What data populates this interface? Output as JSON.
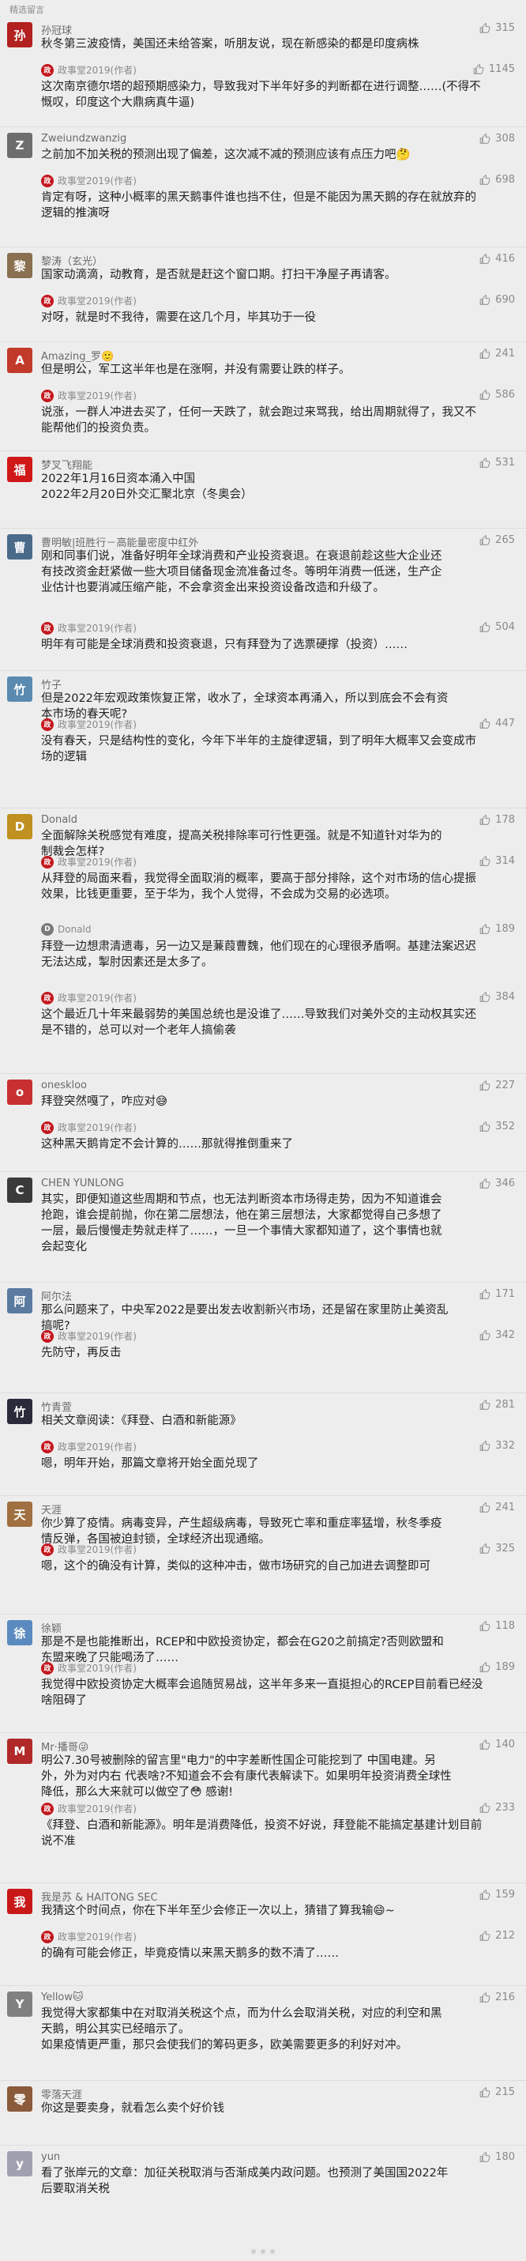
{
  "section_title": "精选留言",
  "comments": [
    {
      "name": "孙冠球",
      "avatar_char": "孙",
      "avatar_color": "#b22020",
      "likes": "315",
      "text": "秋冬第三波疫情，美国还未给答案，听朋友说，现在新感染的都是印度病株",
      "reply": {
        "name": "政事堂2019(作者)",
        "likes": "1145",
        "text": "这次南京德尔塔的超预期感染力，导致我对下半年好多的判断都在进行调整……(不得不慨叹，印度这个大鼎病真牛逼)"
      }
    },
    {
      "name": "Zweiundzwanzig",
      "avatar_char": "Z",
      "avatar_color": "#6d6d6d",
      "likes": "308",
      "text": "之前加不加关税的预测出现了偏差，这次减不减的预测应该有点压力吧🤔",
      "reply": {
        "name": "政事堂2019(作者)",
        "likes": "698",
        "text": "肯定有呀，这种小概率的黑天鹅事件谁也挡不住，但是不能因为黑天鹅的存在就放弃的逻辑的推演呀"
      }
    },
    {
      "name": "黎涛（玄光）",
      "avatar_char": "黎",
      "avatar_color": "#8a7050",
      "likes": "416",
      "text": "国家动滴滴，动教育，是否就是赶这个窗口期。打扫干净屋子再请客。",
      "reply": {
        "name": "政事堂2019(作者)",
        "likes": "690",
        "text": "对呀，就是时不我待，需要在这几个月，毕其功于一役"
      }
    },
    {
      "name": "Amazing_罗🙂",
      "avatar_char": "A",
      "avatar_color": "#c23a2a",
      "likes": "241",
      "text": "但是明公，军工这半年也是在涨啊，并没有需要让跌的样子。",
      "reply": {
        "name": "政事堂2019(作者)",
        "likes": "586",
        "text": "说涨，一群人冲进去买了，任何一天跌了，就会跑过来骂我，给出周期就得了，我又不能帮他们的投资负责。"
      }
    },
    {
      "name": "梦叉飞翔能",
      "avatar_char": "福",
      "avatar_color": "#d01818",
      "likes": "531",
      "text": "2022年1月16日资本涌入中国\n2022年2月20日外交汇聚北京（冬奥会）",
      "reply": null
    },
    {
      "name": "曹明敏|班胜行－高能量密度中红外",
      "avatar_char": "曹",
      "avatar_color": "#4a6a8a",
      "likes": "265",
      "text": "刚和同事们说，准备好明年全球消费和产业投资衰退。在衰退前趁这些大企业还有技改资金赶紧做一些大项目储备现金流准备过冬。等明年消费一低迷，生产企业估计也要消减压缩产能，不会拿资金出来投资设备改造和升级了。",
      "reply": {
        "name": "政事堂2019(作者)",
        "likes": "504",
        "text": "明年有可能是全球消费和投资衰退，只有拜登为了选票硬撑（投资）……"
      }
    },
    {
      "name": "竹子",
      "avatar_char": "竹",
      "avatar_color": "#5a8ab0",
      "likes": "",
      "text": "但是2022年宏观政策恢复正常，收水了，全球资本再涌入，所以到底会不会有资本市场的春天呢?",
      "reply": {
        "name": "政事堂2019(作者)",
        "likes": "447",
        "text": "没有春天，只是结构性的变化，今年下半年的主旋律逻辑，到了明年大概率又会变成市场的逻辑"
      }
    },
    {
      "name": "Donald",
      "avatar_char": "D",
      "avatar_color": "#c09020",
      "likes": "178",
      "text": "全面解除关税感觉有难度，提高关税排除率可行性更强。就是不知道针对华为的制裁会怎样?",
      "reply": {
        "name": "政事堂2019(作者)",
        "likes": "314",
        "text": "从拜登的局面来看，我觉得全面取消的概率，要高于部分排除，这个对市场的信心提振效果，比钱更重要，至于华为，我个人觉得，不会成为交易的必选项。"
      },
      "reply2": {
        "name": "Donald",
        "likes": "189",
        "text": "拜登一边想肃清遗毒，另一边又是蒹葭曹魏，他们现在的心理很矛盾啊。基建法案迟迟无法达成，掣肘因素还是太多了。"
      },
      "reply3": {
        "name": "政事堂2019(作者)",
        "likes": "384",
        "text": "这个最近几十年来最弱势的美国总统也是没谁了……导致我们对美外交的主动权其实还是不错的，总可以对一个老年人搞偷袭"
      }
    },
    {
      "name": "oneskloo",
      "avatar_char": "o",
      "avatar_color": "#c83030",
      "likes": "227",
      "text": "拜登突然嘎了，咋应对😅",
      "reply": {
        "name": "政事堂2019(作者)",
        "likes": "352",
        "text": "这种黑天鹅肯定不会计算的……那就得推倒重来了"
      }
    },
    {
      "name": "CHEN YUNLONG",
      "avatar_char": "C",
      "avatar_color": "#3a3a3a",
      "likes": "346",
      "text": "其实，即便知道这些周期和节点，也无法判断资本市场得走势，因为不知道谁会抢跑，谁会提前抛，你在第二层想法，他在第三层想法，大家都觉得自己多想了一层，最后慢慢走势就走样了……，一旦一个事情大家都知道了，这个事情也就会起变化",
      "reply": null
    },
    {
      "name": "阿尔法",
      "avatar_char": "阿",
      "avatar_color": "#5a7aa0",
      "likes": "171",
      "text": "那么问题来了，中央军2022是要出发去收割新兴市场，还是留在家里防止美资乱搞呢?",
      "reply": {
        "name": "政事堂2019(作者)",
        "likes": "342",
        "text": "先防守，再反击"
      }
    },
    {
      "name": "竹青萱",
      "avatar_char": "竹",
      "avatar_color": "#2a2a3a",
      "likes": "281",
      "text": "相关文章阅读：《拜登、白酒和新能源》",
      "reply": {
        "name": "政事堂2019(作者)",
        "likes": "332",
        "text": "嗯，明年开始，那篇文章将开始全面兑现了"
      }
    },
    {
      "name": "天涯",
      "avatar_char": "天",
      "avatar_color": "#a07040",
      "likes": "241",
      "text": "你少算了疫情。病毒变异，产生超级病毒，导致死亡率和重症率猛增，秋冬季疫情反弹，各国被迫封锁，全球经济出现通缩。",
      "reply": {
        "name": "政事堂2019(作者)",
        "likes": "325",
        "text": "嗯，这个的确没有计算，类似的这种冲击，做市场研究的自己加进去调整即可"
      }
    },
    {
      "name": "徐颖",
      "avatar_char": "徐",
      "avatar_color": "#5a8ac0",
      "likes": "118",
      "text": "那是不是也能推断出，RCEP和中欧投资协定，都会在G20之前搞定?否则欧盟和东盟来晚了只能喝汤了……",
      "reply": {
        "name": "政事堂2019(作者)",
        "likes": "189",
        "text": "我觉得中欧投资协定大概率会追随贸易战，这半年多来一直挺担心的RCEP目前看已经没啥阻碍了"
      }
    },
    {
      "name": "Mr·播哥😜",
      "avatar_char": "M",
      "avatar_color": "#b02828",
      "likes": "140",
      "text": "明公7.30号被删除的留言里\"电力\"的中字差断性国企可能挖到了 中国电建。另外，外为对内右 代表啥?不知道会不会有康代表解读下。如果明年投资消费全球性降低，那么大来就可以做空了😳 感谢!",
      "reply": {
        "name": "政事堂2019(作者)",
        "likes": "233",
        "text": "《拜登、白酒和新能源》。明年是消费降低，投资不好说，拜登能不能搞定基建计划目前说不准"
      }
    },
    {
      "name": "我是苏 & HAITONG SEC",
      "avatar_char": "我",
      "avatar_color": "#c81818",
      "likes": "159",
      "text": "我猜这个时间点，你在下半年至少会修正一次以上，猜错了算我输😄~",
      "reply": {
        "name": "政事堂2019(作者)",
        "likes": "212",
        "text": "的确有可能会修正，毕竟疫情以来黑天鹅多的数不清了……"
      }
    },
    {
      "name": "Yellow🐱",
      "avatar_char": "Y",
      "avatar_color": "#808080",
      "likes": "216",
      "text": "我觉得大家都集中在对取消关税这个点，而为什么会取消关税，对应的利空和黑天鹅，明公其实已经暗示了。\n如果疫情更严重，那只会使我们的筹码更多，欧美需要更多的利好对冲。",
      "reply": null
    },
    {
      "name": "零落天涯",
      "avatar_char": "零",
      "avatar_color": "#8a5a3a",
      "likes": "215",
      "text": "你这是要卖身，就看怎么卖个好价钱",
      "reply": null
    },
    {
      "name": "yun",
      "avatar_char": "y",
      "avatar_color": "#a0a0b0",
      "likes": "180",
      "text": "看了张岸元的文章：加征关税取消与否渐成美内政问题。也预测了美国国2022年后要取消关税",
      "reply": null
    }
  ]
}
